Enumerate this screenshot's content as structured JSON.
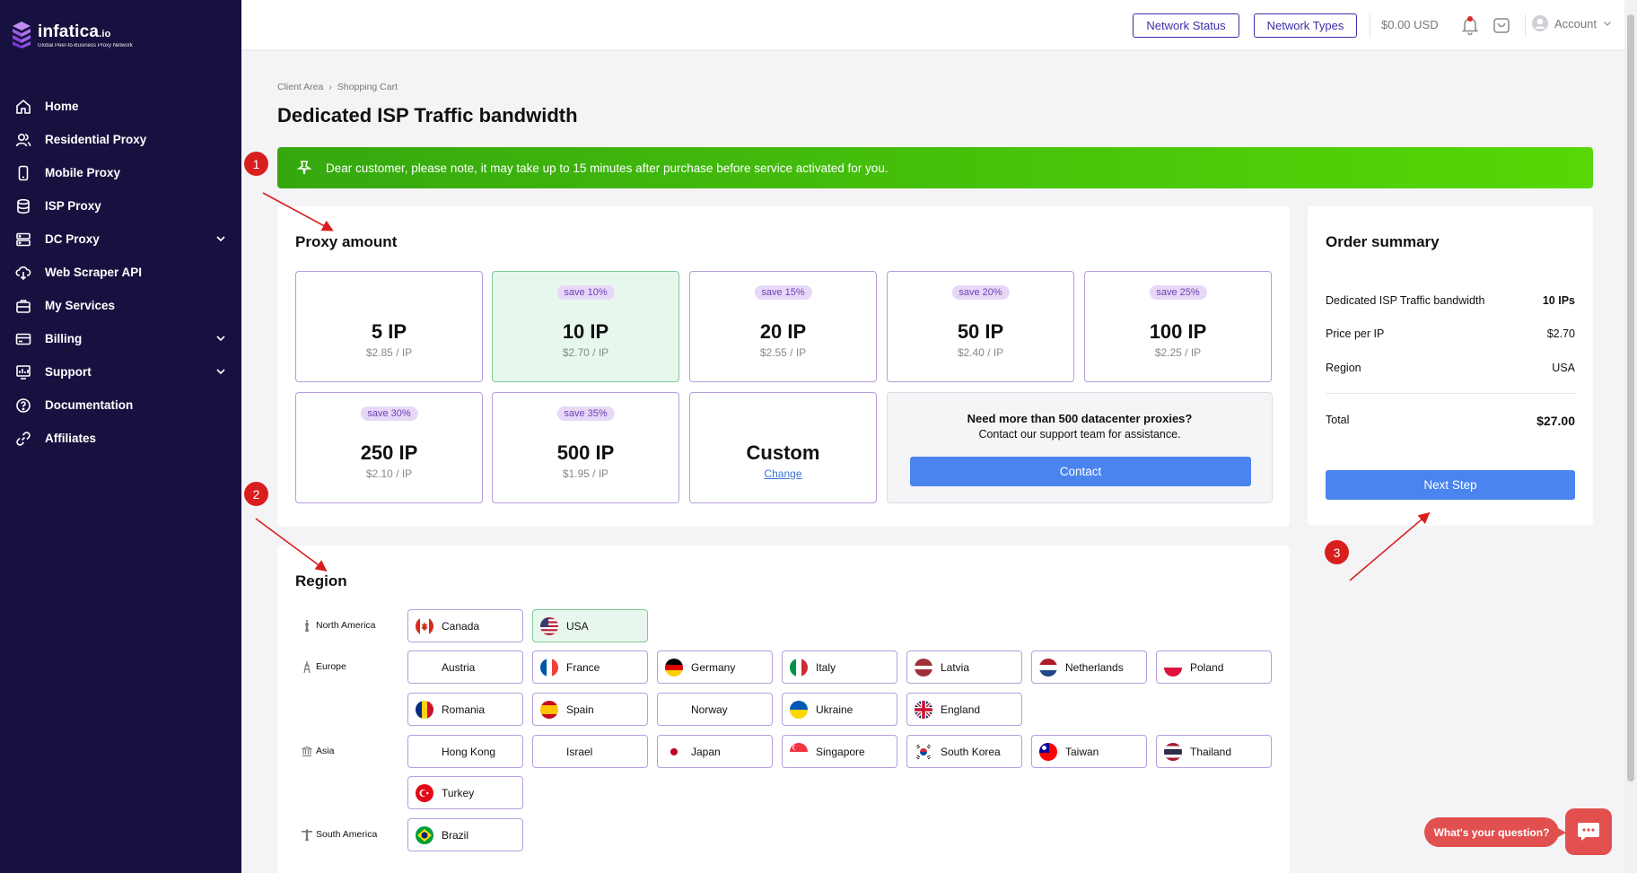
{
  "brand": {
    "name": "infatica",
    "suffix": ".io",
    "tagline": "Global Peer-to-Business Proxy Network"
  },
  "sidebar": {
    "items": [
      {
        "label": "Home",
        "icon": "home-icon",
        "has_chevron": false
      },
      {
        "label": "Residential Proxy",
        "icon": "users-icon",
        "has_chevron": false
      },
      {
        "label": "Mobile Proxy",
        "icon": "phone-icon",
        "has_chevron": false
      },
      {
        "label": "ISP Proxy",
        "icon": "database-icon",
        "has_chevron": false
      },
      {
        "label": "DC Proxy",
        "icon": "server-icon",
        "has_chevron": true
      },
      {
        "label": "Web Scraper API",
        "icon": "cloud-icon",
        "has_chevron": false
      },
      {
        "label": "My Services",
        "icon": "briefcase-icon",
        "has_chevron": false
      },
      {
        "label": "Billing",
        "icon": "card-icon",
        "has_chevron": true
      },
      {
        "label": "Support",
        "icon": "chart-icon",
        "has_chevron": true
      },
      {
        "label": "Documentation",
        "icon": "question-icon",
        "has_chevron": false
      },
      {
        "label": "Affiliates",
        "icon": "link-icon",
        "has_chevron": false
      }
    ]
  },
  "topbar": {
    "network_status": "Network Status",
    "network_types": "Network Types",
    "balance": "$0.00 USD",
    "account": "Account"
  },
  "breadcrumb": {
    "items": [
      "Client Area",
      "Shopping Cart"
    ]
  },
  "page_title": "Dedicated ISP Traffic bandwidth",
  "notice": "Dear customer, please note, it may take up to 15 minutes after purchase before service activated for you.",
  "proxy_amount": {
    "title": "Proxy amount",
    "options": [
      {
        "amount": "5 IP",
        "price": "$2.85 / IP",
        "badge": "",
        "selected": false
      },
      {
        "amount": "10 IP",
        "price": "$2.70 / IP",
        "badge": "save 10%",
        "selected": true
      },
      {
        "amount": "20 IP",
        "price": "$2.55 / IP",
        "badge": "save 15%",
        "selected": false
      },
      {
        "amount": "50 IP",
        "price": "$2.40 / IP",
        "badge": "save 20%",
        "selected": false
      },
      {
        "amount": "100 IP",
        "price": "$2.25 / IP",
        "badge": "save 25%",
        "selected": false
      },
      {
        "amount": "250 IP",
        "price": "$2.10 / IP",
        "badge": "save 30%",
        "selected": false
      },
      {
        "amount": "500 IP",
        "price": "$1.95 / IP",
        "badge": "save 35%",
        "selected": false
      }
    ],
    "custom": {
      "label": "Custom",
      "link": "Change"
    },
    "more": {
      "heading": "Need more than 500 datacenter proxies?",
      "subtext": "Contact our support team for assistance.",
      "button": "Contact"
    }
  },
  "order_summary": {
    "title": "Order summary",
    "rows": [
      {
        "label": "Dedicated ISP Traffic bandwidth",
        "value": "10 IPs"
      },
      {
        "label": "Price per IP",
        "value": "$2.70"
      },
      {
        "label": "Region",
        "value": "USA"
      }
    ],
    "total_label": "Total",
    "total_value": "$27.00",
    "next_button": "Next Step"
  },
  "region": {
    "title": "Region",
    "groups": [
      {
        "name": "North America",
        "countries": [
          {
            "name": "Canada",
            "flag": "ca",
            "selected": false
          },
          {
            "name": "USA",
            "flag": "us",
            "selected": true
          }
        ]
      },
      {
        "name": "Europe",
        "countries": [
          {
            "name": "Austria",
            "flag": "",
            "selected": false
          },
          {
            "name": "France",
            "flag": "fr",
            "selected": false
          },
          {
            "name": "Germany",
            "flag": "de",
            "selected": false
          },
          {
            "name": "Italy",
            "flag": "it",
            "selected": false
          },
          {
            "name": "Latvia",
            "flag": "lv",
            "selected": false
          },
          {
            "name": "Netherlands",
            "flag": "nl",
            "selected": false
          },
          {
            "name": "Poland",
            "flag": "pl",
            "selected": false
          },
          {
            "name": "Romania",
            "flag": "ro",
            "selected": false
          },
          {
            "name": "Spain",
            "flag": "es",
            "selected": false
          },
          {
            "name": "Norway",
            "flag": "",
            "selected": false
          },
          {
            "name": "Ukraine",
            "flag": "ua",
            "selected": false
          },
          {
            "name": "England",
            "flag": "gb",
            "selected": false
          }
        ]
      },
      {
        "name": "Asia",
        "countries": [
          {
            "name": "Hong Kong",
            "flag": "",
            "selected": false
          },
          {
            "name": "Israel",
            "flag": "",
            "selected": false
          },
          {
            "name": "Japan",
            "flag": "jp",
            "selected": false
          },
          {
            "name": "Singapore",
            "flag": "sg",
            "selected": false
          },
          {
            "name": "South Korea",
            "flag": "kr",
            "selected": false
          },
          {
            "name": "Taiwan",
            "flag": "tw",
            "selected": false
          },
          {
            "name": "Thailand",
            "flag": "th",
            "selected": false
          },
          {
            "name": "Turkey",
            "flag": "tr",
            "selected": false
          }
        ]
      },
      {
        "name": "South America",
        "countries": [
          {
            "name": "Brazil",
            "flag": "br",
            "selected": false
          }
        ]
      }
    ]
  },
  "annotations": [
    "1",
    "2",
    "3"
  ],
  "chat": {
    "prompt": "What's your question?"
  },
  "colors": {
    "sidebar": "#17113f",
    "accent": "#3b2fa8",
    "primary_button": "#4a84ee",
    "notice_start": "#35a80f",
    "notice_end": "#56d806",
    "annotation": "#d91e1e",
    "chat": "#e24f4f",
    "selected_bg": "#e8f7ee"
  }
}
